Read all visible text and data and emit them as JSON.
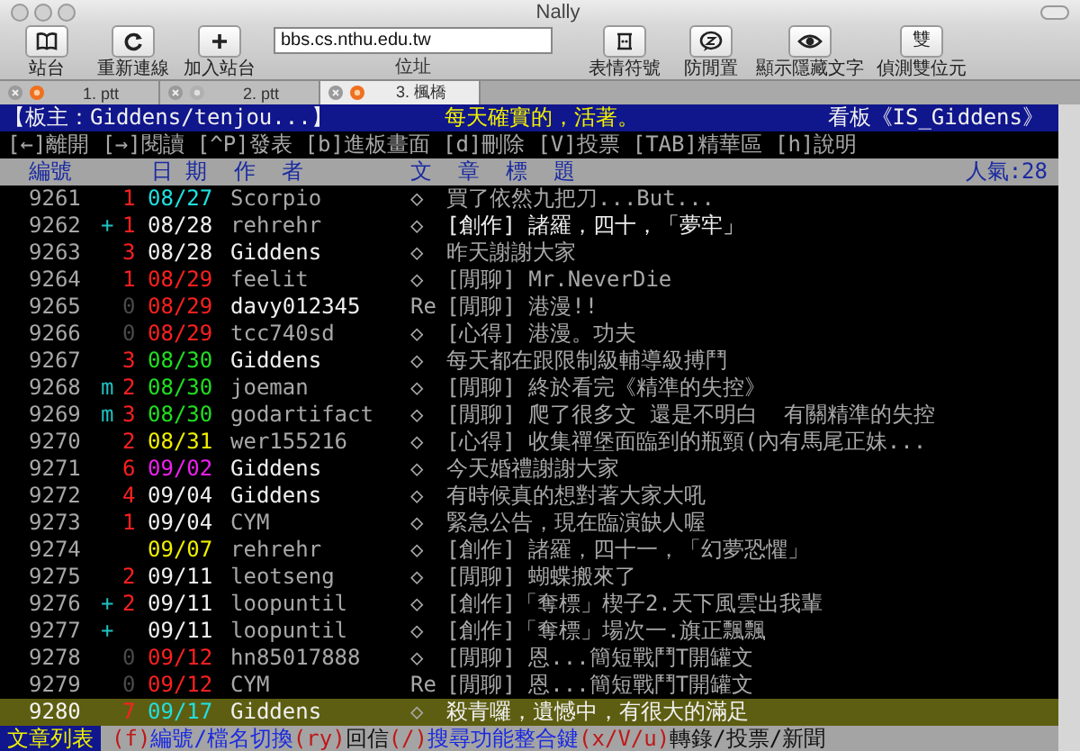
{
  "window": {
    "title": "Nally"
  },
  "toolbar": {
    "buttons": [
      {
        "label": "站台"
      },
      {
        "label": "重新連線"
      },
      {
        "label": "加入站台"
      }
    ],
    "address": {
      "value": "bbs.cs.nthu.edu.tw",
      "label": "位址"
    },
    "right_buttons": [
      {
        "label": "表情符號"
      },
      {
        "label": "防閒置"
      },
      {
        "label": "顯示隱藏文字"
      },
      {
        "label": "偵測雙位元",
        "glyph": "雙"
      }
    ]
  },
  "tabs": [
    {
      "label": "1. ptt",
      "selected": false,
      "connected": true
    },
    {
      "label": "2. ptt",
      "selected": false,
      "connected": false
    },
    {
      "label": "3. 楓橋",
      "selected": true,
      "connected": true
    }
  ],
  "terminal": {
    "board_header": {
      "moderator": "【板主：Giddens/tenjou...】",
      "motto": "每天確實的，活著。",
      "board": "看板《IS_Giddens》"
    },
    "keys": [
      "[←]離開",
      "[→]閱讀",
      "[^P]發表",
      "[b]進板畫面",
      "[d]刪除",
      "[V]投票",
      "[TAB]精華區",
      "[h]說明"
    ],
    "columns": [
      "編號",
      "日 期",
      "作  者",
      "文  章  標  題"
    ],
    "popularity": "人氣:28",
    "rows": [
      {
        "number": "9261",
        "mark": "",
        "count": {
          "text": "1",
          "color": "#ff2020"
        },
        "date": {
          "text": "08/27",
          "color": "#20e0e0"
        },
        "author": "Scorpio",
        "author_bright": false,
        "prefix": "◇",
        "title": "買了依然九把刀...But...",
        "title_bright": false,
        "selected": false
      },
      {
        "number": "9262",
        "mark": "+",
        "count": {
          "text": "1",
          "color": "#ff2020"
        },
        "date": {
          "text": "08/28",
          "color": "#f0f0f0"
        },
        "author": "rehrehr",
        "author_bright": false,
        "prefix": "◇",
        "title": "[創作] 諸羅，四十，「夢牢」",
        "title_bright": true,
        "selected": false
      },
      {
        "number": "9263",
        "mark": "",
        "count": {
          "text": "3",
          "color": "#ff2020"
        },
        "date": {
          "text": "08/28",
          "color": "#f0f0f0"
        },
        "author": "Giddens",
        "author_bright": true,
        "prefix": "◇",
        "title": "昨天謝謝大家",
        "title_bright": false,
        "selected": false
      },
      {
        "number": "9264",
        "mark": "",
        "count": {
          "text": "1",
          "color": "#ff2020"
        },
        "date": {
          "text": "08/29",
          "color": "#ff2020"
        },
        "author": "feelit",
        "author_bright": false,
        "prefix": "◇",
        "title": "[閒聊] Mr.NeverDie",
        "title_bright": false,
        "selected": false
      },
      {
        "number": "9265",
        "mark": "",
        "count": {
          "text": "0",
          "color": "#4a4a4a"
        },
        "date": {
          "text": "08/29",
          "color": "#ff2020"
        },
        "author": "davy012345",
        "author_bright": true,
        "prefix": "Re",
        "title": "[閒聊] 港漫!!",
        "title_bright": false,
        "selected": false
      },
      {
        "number": "9266",
        "mark": "",
        "count": {
          "text": "0",
          "color": "#4a4a4a"
        },
        "date": {
          "text": "08/29",
          "color": "#ff2020"
        },
        "author": "tcc740sd",
        "author_bright": false,
        "prefix": "◇",
        "title": "[心得] 港漫。功夫",
        "title_bright": false,
        "selected": false
      },
      {
        "number": "9267",
        "mark": "",
        "count": {
          "text": "3",
          "color": "#ff2020"
        },
        "date": {
          "text": "08/30",
          "color": "#20e020"
        },
        "author": "Giddens",
        "author_bright": true,
        "prefix": "◇",
        "title": "每天都在跟限制級輔導級搏鬥",
        "title_bright": false,
        "selected": false
      },
      {
        "number": "9268",
        "mark": "m",
        "count": {
          "text": "2",
          "color": "#ff2020"
        },
        "date": {
          "text": "08/30",
          "color": "#20e020"
        },
        "author": "joeman",
        "author_bright": false,
        "prefix": "◇",
        "title": "[閒聊] 終於看完《精準的失控》",
        "title_bright": false,
        "selected": false
      },
      {
        "number": "9269",
        "mark": "m",
        "count": {
          "text": "3",
          "color": "#ff2020"
        },
        "date": {
          "text": "08/30",
          "color": "#20e020"
        },
        "author": "godartifact",
        "author_bright": false,
        "prefix": "◇",
        "title": "[閒聊] 爬了很多文 還是不明白  有關精準的失控",
        "title_bright": false,
        "selected": false
      },
      {
        "number": "9270",
        "mark": "",
        "count": {
          "text": "2",
          "color": "#ff2020"
        },
        "date": {
          "text": "08/31",
          "color": "#f0f000"
        },
        "author": "wer155216",
        "author_bright": false,
        "prefix": "◇",
        "title": "[心得] 收集禪堡面臨到的瓶頸(內有馬尾正妹...",
        "title_bright": false,
        "selected": false
      },
      {
        "number": "9271",
        "mark": "",
        "count": {
          "text": "6",
          "color": "#ff2020"
        },
        "date": {
          "text": "09/02",
          "color": "#f020f0"
        },
        "author": "Giddens",
        "author_bright": true,
        "prefix": "◇",
        "title": "今天婚禮謝謝大家",
        "title_bright": false,
        "selected": false
      },
      {
        "number": "9272",
        "mark": "",
        "count": {
          "text": "4",
          "color": "#ff2020"
        },
        "date": {
          "text": "09/04",
          "color": "#f0f0f0"
        },
        "author": "Giddens",
        "author_bright": true,
        "prefix": "◇",
        "title": "有時候真的想對著大家大吼",
        "title_bright": false,
        "selected": false
      },
      {
        "number": "9273",
        "mark": "",
        "count": {
          "text": "1",
          "color": "#ff2020"
        },
        "date": {
          "text": "09/04",
          "color": "#f0f0f0"
        },
        "author": "CYM",
        "author_bright": false,
        "prefix": "◇",
        "title": "緊急公告，現在臨演缺人喔",
        "title_bright": false,
        "selected": false
      },
      {
        "number": "9274",
        "mark": "",
        "date": {
          "text": "09/07",
          "color": "#f0f000"
        },
        "author": "rehrehr",
        "author_bright": false,
        "prefix": "◇",
        "title": "[創作] 諸羅，四十一，「幻夢恐懼」",
        "title_bright": false,
        "selected": false
      },
      {
        "number": "9275",
        "mark": "",
        "count": {
          "text": "2",
          "color": "#ff2020"
        },
        "date": {
          "text": "09/11",
          "color": "#f0f0f0"
        },
        "author": "leotseng",
        "author_bright": false,
        "prefix": "◇",
        "title": "[閒聊] 蝴蝶搬來了",
        "title_bright": false,
        "selected": false
      },
      {
        "number": "9276",
        "mark": "+",
        "count": {
          "text": "2",
          "color": "#ff2020"
        },
        "date": {
          "text": "09/11",
          "color": "#f0f0f0"
        },
        "author": "loopuntil",
        "author_bright": false,
        "prefix": "◇",
        "title": "[創作]「奪標」楔子2.天下風雲出我輩",
        "title_bright": false,
        "selected": false
      },
      {
        "number": "9277",
        "mark": "+",
        "date": {
          "text": "09/11",
          "color": "#f0f0f0"
        },
        "author": "loopuntil",
        "author_bright": false,
        "prefix": "◇",
        "title": "[創作]「奪標」場次一.旗正飄飄",
        "title_bright": false,
        "selected": false
      },
      {
        "number": "9278",
        "mark": "",
        "count": {
          "text": "0",
          "color": "#4a4a4a"
        },
        "date": {
          "text": "09/12",
          "color": "#ff2020"
        },
        "author": "hn85017888",
        "author_bright": false,
        "prefix": "◇",
        "title": "[閒聊] 恩...簡短戰鬥T開罐文",
        "title_bright": false,
        "selected": false
      },
      {
        "number": "9279",
        "mark": "",
        "count": {
          "text": "0",
          "color": "#4a4a4a"
        },
        "date": {
          "text": "09/12",
          "color": "#ff2020"
        },
        "author": "CYM",
        "author_bright": false,
        "prefix": "Re",
        "title": "[閒聊] 恩...簡短戰鬥T開罐文",
        "title_bright": false,
        "selected": false
      },
      {
        "number": "9280",
        "mark": "",
        "count": {
          "text": "7",
          "color": "#ff2020"
        },
        "date": {
          "text": "09/17",
          "color": "#20e0e0"
        },
        "author": "Giddens",
        "author_bright": true,
        "prefix": "◇",
        "title": "殺青囉，遺憾中，有很大的滿足",
        "title_bright": true,
        "selected": true
      }
    ],
    "status_bar": {
      "mode": "文章列表",
      "items": [
        {
          "text": "(f)",
          "kind": "key"
        },
        {
          "text": "編號/檔名切換",
          "kind": "link"
        },
        {
          "text": "(ry)",
          "kind": "key"
        },
        {
          "text": "回信",
          "kind": "plain"
        },
        {
          "text": "(/)",
          "kind": "key"
        },
        {
          "text": "搜尋功能整合鍵",
          "kind": "link"
        },
        {
          "text": "(x/V/u)",
          "kind": "key"
        },
        {
          "text": "轉錄/投票/新聞",
          "kind": "plain"
        }
      ]
    }
  }
}
